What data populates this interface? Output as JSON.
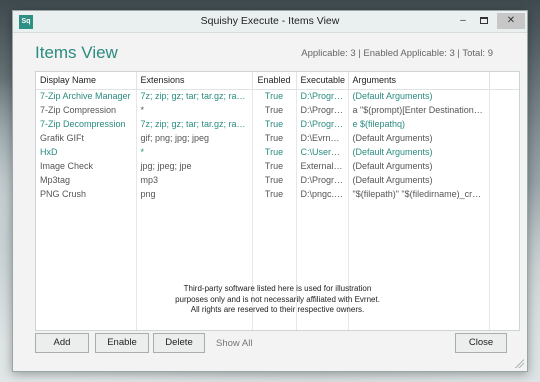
{
  "window": {
    "app_icon_text": "Sq",
    "title": "Squishy Execute - Items View",
    "min_glyph": "–",
    "close_glyph": "✕"
  },
  "header": {
    "title": "Items View",
    "counts": "Applicable: 3 | Enabled Applicable: 3 | Total: 9"
  },
  "table": {
    "columns": [
      "Display Name",
      "Extensions",
      "Enabled",
      "Executable",
      "Arguments"
    ],
    "rows": [
      {
        "name": "7-Zip Archive Manager",
        "ext": "7z; zip; gz; tar; tar.gz; rar;...",
        "enabled": "True",
        "exe": "D:\\Progra...",
        "args": "(Default Arguments)",
        "active": true
      },
      {
        "name": "7-Zip Compression",
        "ext": "*",
        "enabled": "True",
        "exe": "D:\\Progra...",
        "args": "a \"$(prompt)[Enter Destination:]\" -...",
        "active": false
      },
      {
        "name": "7-Zip Decompression",
        "ext": "7z; zip; gz; tar; tar.gz; rar;...",
        "enabled": "True",
        "exe": "D:\\Progra...",
        "args": "e $(filepathq)",
        "active": true
      },
      {
        "name": "Grafik GIFt",
        "ext": "gif; png; jpg; jpeg",
        "enabled": "True",
        "exe": "D:\\Evrnet...",
        "args": "(Default Arguments)",
        "active": false
      },
      {
        "name": "HxD",
        "ext": "*",
        "enabled": "True",
        "exe": "C:\\Users\\...",
        "args": "(Default Arguments)",
        "active": true
      },
      {
        "name": "Image Check",
        "ext": "jpg; jpeg; jpe",
        "enabled": "True",
        "exe": "External\\I...",
        "args": "(Default Arguments)",
        "active": false
      },
      {
        "name": "Mp3tag",
        "ext": "mp3",
        "enabled": "True",
        "exe": "D:\\Progra...",
        "args": "(Default Arguments)",
        "active": false
      },
      {
        "name": "PNG Crush",
        "ext": "png",
        "enabled": "True",
        "exe": "D:\\pngc.e...",
        "args": "\"$(filepath)\" \"$(filedirname)_crushe...",
        "active": false
      }
    ]
  },
  "notice": {
    "line1": "Third-party software listed here is used for illustration",
    "line2": "purposes only and is not necessarily affiliated with Evrnet.",
    "line3": "All rights are reserved to their respective owners."
  },
  "buttons": {
    "add": "Add",
    "enable": "Enable",
    "delete": "Delete",
    "show_all": "Show All",
    "close": "Close"
  },
  "colors": {
    "accent": "#2a8c80"
  }
}
